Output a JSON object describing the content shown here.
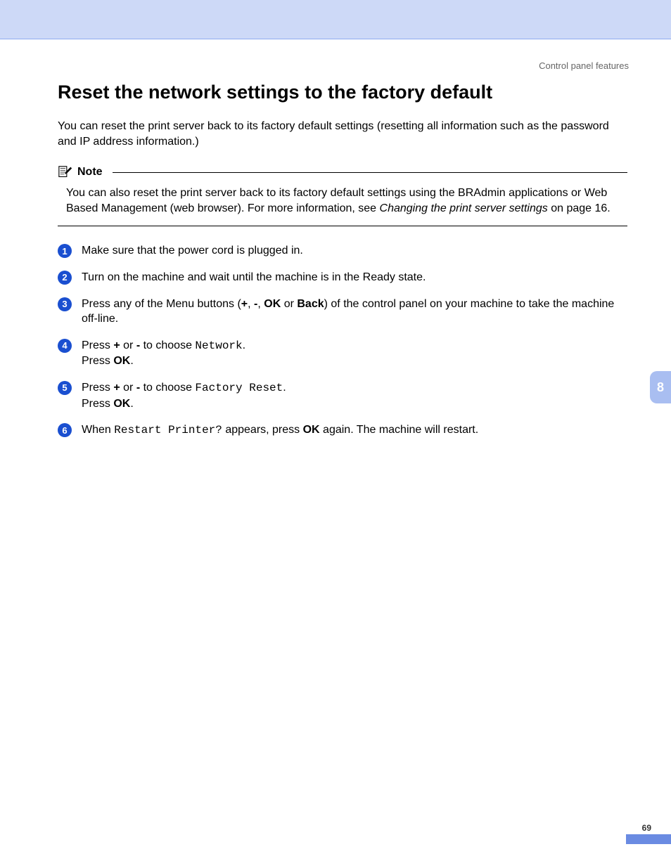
{
  "header": {
    "section": "Control panel features"
  },
  "title": "Reset the network settings to the factory default",
  "intro": "You can reset the print server back to its factory default settings (resetting all information such as the password and IP address information.)",
  "note": {
    "label": "Note",
    "body_prefix": "You can also reset the print server back to its factory default settings using the BRAdmin applications or Web Based Management (web browser). For more information, see ",
    "body_italic": "Changing the print server settings",
    "body_suffix": " on page 16."
  },
  "steps": {
    "s1": "Make sure that the power cord is plugged in.",
    "s2": "Turn on the machine and wait until the machine is in the Ready state.",
    "s3": {
      "pre": "Press any of the Menu buttons (",
      "plus": "+",
      "c1": ", ",
      "minus": "-",
      "c2": ", ",
      "ok": "OK",
      "c3": " or ",
      "back": "Back",
      "post": ") of the control panel on your machine to take the machine off-line."
    },
    "s4": {
      "pre": "Press ",
      "plus": "+",
      "c1": " or ",
      "minus": "-",
      "c2": " to choose ",
      "code": "Network",
      "post": ".",
      "line2a": "Press ",
      "ok": "OK",
      "line2b": "."
    },
    "s5": {
      "pre": "Press ",
      "plus": "+",
      "c1": " or ",
      "minus": "-",
      "c2": " to choose ",
      "code": "Factory Reset",
      "post": ".",
      "line2a": "Press ",
      "ok": "OK",
      "line2b": "."
    },
    "s6": {
      "pre": "When ",
      "code": "Restart Printer?",
      "mid": " appears, press ",
      "ok": "OK",
      "post": " again. The machine will restart."
    }
  },
  "chapter_tab": "8",
  "page_number": "69"
}
